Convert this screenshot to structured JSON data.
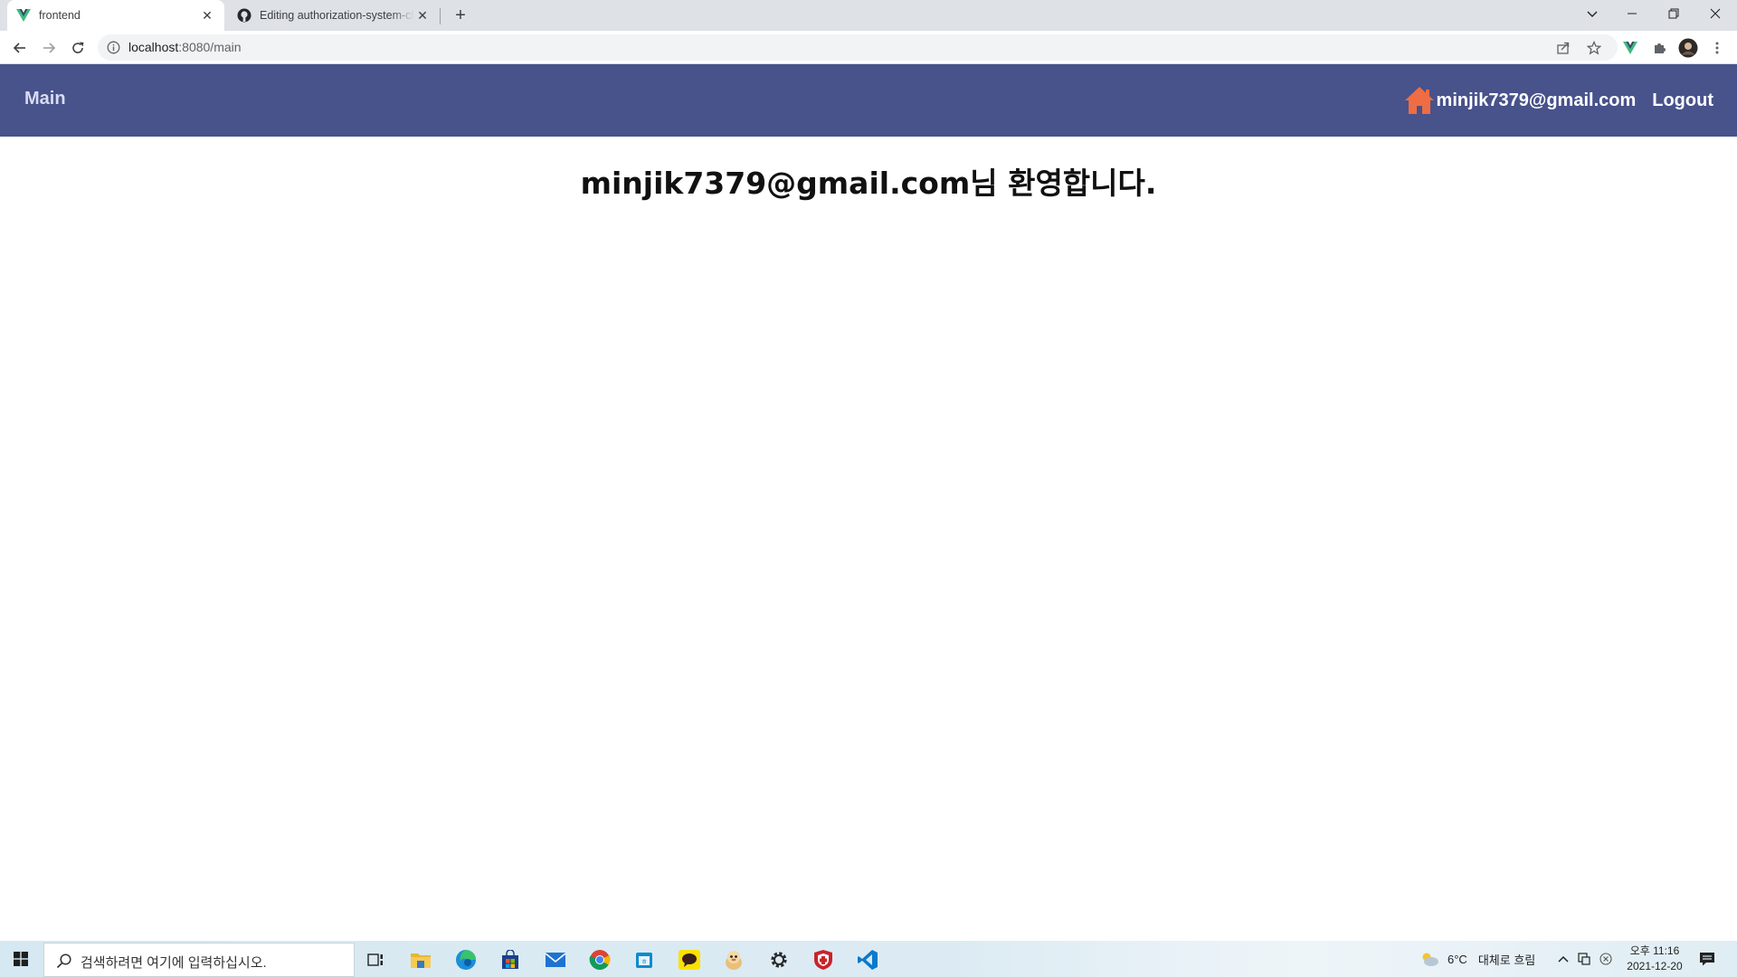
{
  "browser": {
    "tabs": [
      {
        "title": "frontend",
        "active": true,
        "icon": "vue-logo-icon"
      },
      {
        "title": "Editing authorization-system-client",
        "active": false,
        "icon": "github-icon"
      }
    ],
    "address": {
      "host": "localhost",
      "rest": ":8080/main"
    }
  },
  "app": {
    "nav": {
      "main_label": "Main",
      "user_email": "minjik7379@gmail.com",
      "logout_label": "Logout"
    },
    "welcome_email": "minjik7379@gmail.com",
    "welcome_suffix": "님 환영합니다."
  },
  "taskbar": {
    "search_placeholder": "검색하려면 여기에 입력하십시오.",
    "apps": [
      "task-view-icon",
      "file-explorer-icon",
      "edge-icon",
      "store-icon",
      "mail-icon",
      "chrome-icon",
      "calendar-icon",
      "kakaotalk-icon",
      "character-app-icon",
      "settings-icon",
      "antivirus-icon",
      "vscode-icon"
    ],
    "weather": {
      "temp": "6°C",
      "desc": "대체로 흐림"
    },
    "clock": {
      "time": "오후 11:16",
      "date": "2021-12-20"
    }
  },
  "colors": {
    "nav_bg": "#48528b",
    "house_icon": "#f06c43",
    "nav_main_text": "#d8dcf2"
  }
}
